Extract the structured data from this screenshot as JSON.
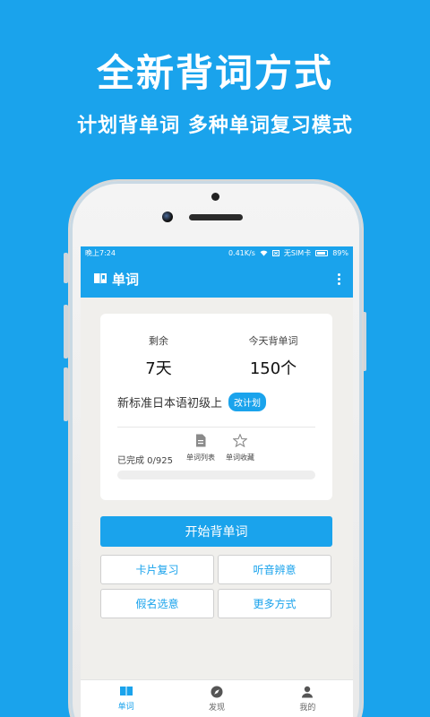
{
  "promo": {
    "title": "全新背词方式",
    "subtitle": "计划背单词  多种单词复习模式"
  },
  "statusbar": {
    "time": "晚上7:24",
    "speed": "0.41K/s",
    "sim": "无SIM卡",
    "battery": "89%"
  },
  "appbar": {
    "title": "单词",
    "icon": "book-icon",
    "menu_icon": "more-vertical-icon"
  },
  "plan": {
    "remaining_label": "剩余",
    "remaining_value": "7天",
    "today_label": "今天背单词",
    "today_value": "150个",
    "book_name": "新标准日本语初级上",
    "change_plan_label": "改计划",
    "completed_text": "已完成 0/925",
    "progress": 0,
    "word_list_label": "单词列表",
    "word_list_icon": "document-icon",
    "favorites_label": "单词收藏",
    "favorites_icon": "star-icon"
  },
  "actions": {
    "start_label": "开始背单词",
    "modes": [
      "卡片复习",
      "听音辨意",
      "假名选意",
      "更多方式"
    ]
  },
  "nav": {
    "items": [
      {
        "label": "单词",
        "icon": "book-icon",
        "active": true
      },
      {
        "label": "发现",
        "icon": "compass-icon",
        "active": false
      },
      {
        "label": "我的",
        "icon": "person-icon",
        "active": false
      }
    ]
  },
  "colors": {
    "accent": "#1aa3ec",
    "background": "#f0efec"
  }
}
